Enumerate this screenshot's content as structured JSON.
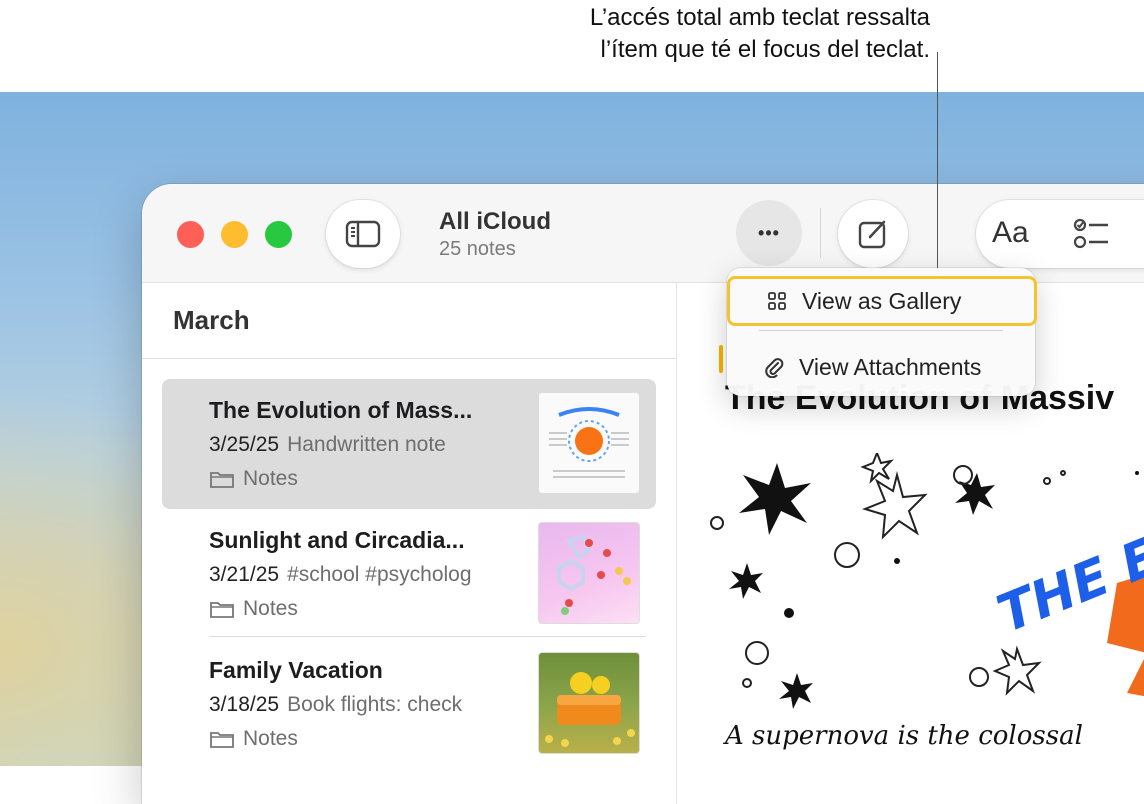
{
  "callout": {
    "line1": "L’accés total amb teclat ressalta",
    "line2": "l’ítem que té el focus del teclat."
  },
  "toolbar": {
    "folder_title": "All iCloud",
    "note_count": "25 notes",
    "more_label": "•••",
    "format_label": "Aa"
  },
  "menu": {
    "items": [
      {
        "label": "View as Gallery",
        "icon": "gallery-grid-icon",
        "focused": true
      },
      {
        "label": "View Attachments",
        "icon": "paperclip-icon",
        "focused": false
      }
    ]
  },
  "list": {
    "section": "March",
    "notes": [
      {
        "title": "The Evolution of Mass...",
        "date": "3/25/25",
        "snippet": "Handwritten note",
        "folder": "Notes",
        "selected": true
      },
      {
        "title": "Sunlight and Circadia...",
        "date": "3/21/25",
        "snippet": "#school #psycholog",
        "folder": "Notes",
        "selected": false
      },
      {
        "title": "Family Vacation",
        "date": "3/18/25",
        "snippet": "Book flights: check",
        "folder": "Notes",
        "selected": false
      }
    ]
  },
  "editor": {
    "heading": "The Evolution of Massiv",
    "drawing_title": "THE EV",
    "handwriting": "A supernova is the colossal"
  },
  "colors": {
    "focus_ring": "#f4c430",
    "close": "#fe5f57",
    "minimize": "#febc2e",
    "zoom": "#28c840"
  }
}
